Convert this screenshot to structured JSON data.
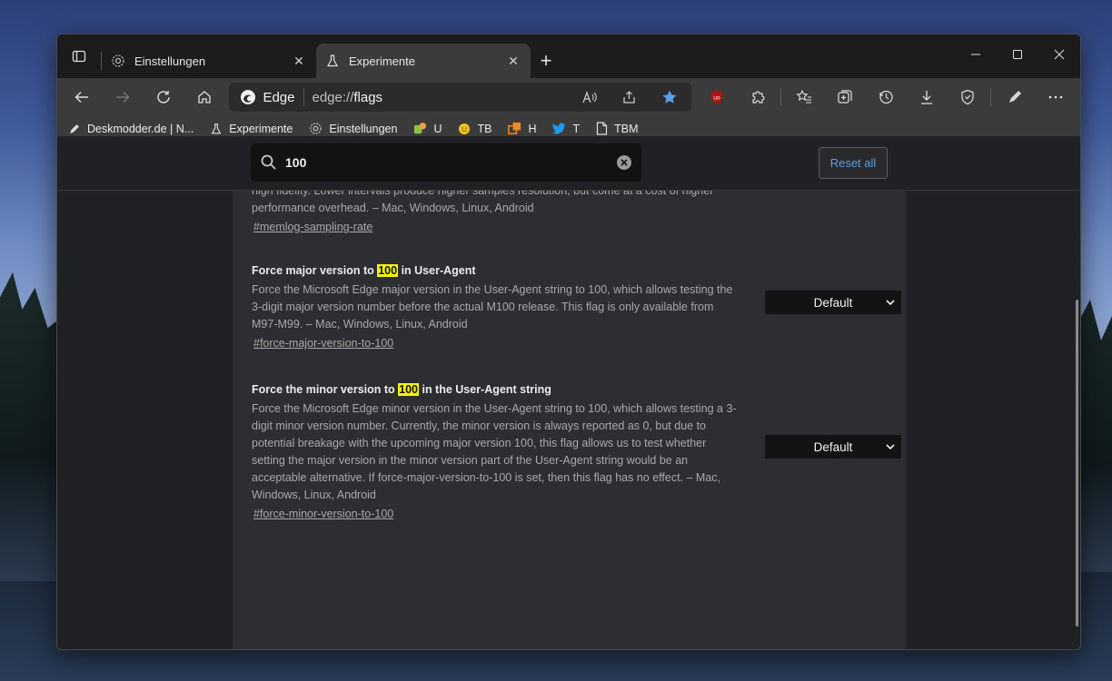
{
  "tabs": [
    {
      "title": "Einstellungen",
      "icon": "gear-icon",
      "active": false
    },
    {
      "title": "Experimente",
      "icon": "flask-icon",
      "active": true
    }
  ],
  "toolbar": {
    "brand": "Edge",
    "url_scheme": "edge://",
    "url_path": "flags"
  },
  "bookmarks": [
    {
      "label": "Deskmodder.de | N...",
      "icon": "pen-icon"
    },
    {
      "label": "Experimente",
      "icon": "flask-icon"
    },
    {
      "label": "Einstellungen",
      "icon": "gear-icon"
    },
    {
      "label": "U",
      "icon": "recycle-icon"
    },
    {
      "label": "TB",
      "icon": "smiley-icon"
    },
    {
      "label": "H",
      "icon": "windows-icon"
    },
    {
      "label": "T",
      "icon": "twitter-icon"
    },
    {
      "label": "TBM",
      "icon": "document-icon"
    }
  ],
  "search": {
    "query": "100"
  },
  "reset_label": "Reset all",
  "partial": {
    "desc_top": "high fidelity. Lower intervals produce higher samples resolution, but come at a cost of higher",
    "desc": "performance overhead. – Mac, Windows, Linux, Android",
    "link": "#memlog-sampling-rate"
  },
  "experiments": [
    {
      "title_before": "Force major version to ",
      "title_highlight": "100",
      "title_after": " in User-Agent",
      "desc": "Force the Microsoft Edge major version in the User-Agent string to 100, which allows testing the 3-digit major version number before the actual M100 release. This flag is only available from M97-M99. – Mac, Windows, Linux, Android",
      "link": "#force-major-version-to-100",
      "select": "Default"
    },
    {
      "title_before": "Force the minor version to ",
      "title_highlight": "100",
      "title_after": " in the User-Agent string",
      "desc": "Force the Microsoft Edge minor version in the User-Agent string to 100, which allows testing a 3-digit minor version number. Currently, the minor version is always reported as 0, but due to potential breakage with the upcoming major version 100, this flag allows us to test whether setting the major version in the minor version part of the User-Agent string would be an acceptable alternative. If force-major-version-to-100 is set, then this flag has no effect. – Mac, Windows, Linux, Android",
      "link": "#force-minor-version-to-100",
      "select": "Default"
    }
  ]
}
